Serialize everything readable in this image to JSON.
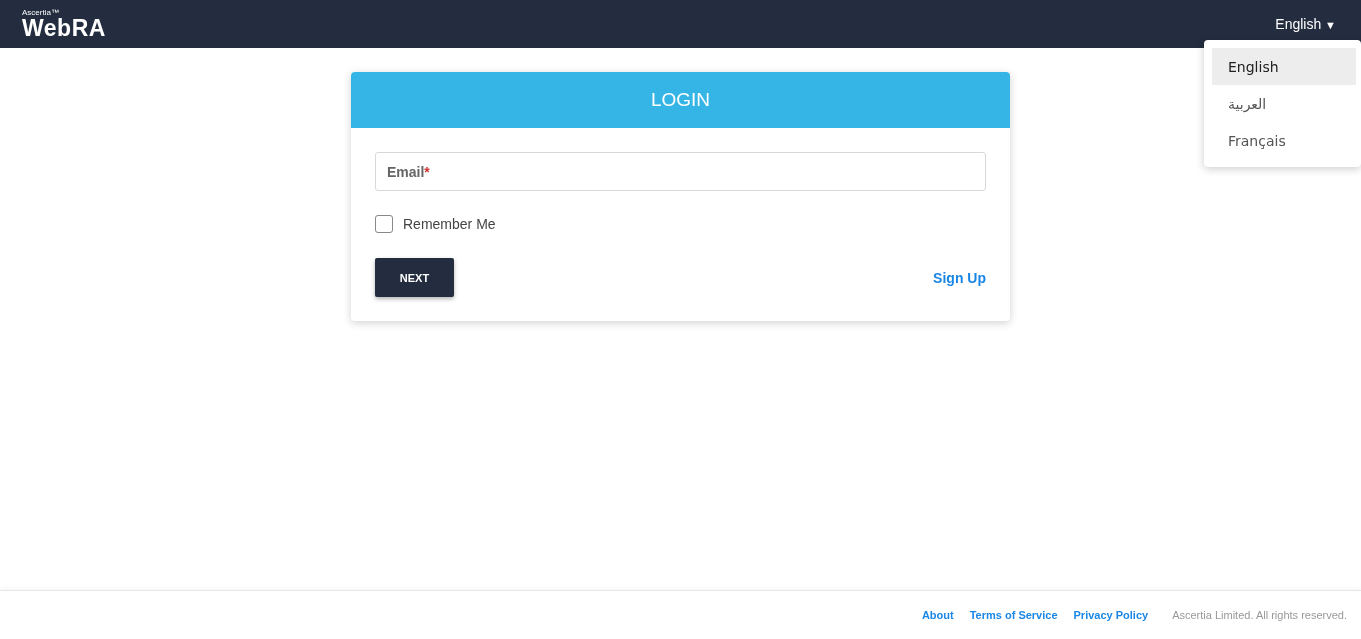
{
  "header": {
    "brand_small": "Ascertia™",
    "brand": "WebRA",
    "language": "English",
    "language_caret": "▼"
  },
  "language_menu": [
    {
      "label": "English",
      "selected": true
    },
    {
      "label": "العربية",
      "selected": false
    },
    {
      "label": "Français",
      "selected": false
    }
  ],
  "login": {
    "title": "LOGIN",
    "email_field": {
      "label": "Email",
      "required": true,
      "required_mark": "*"
    },
    "remember_me": {
      "label": "Remember Me",
      "checked": false
    },
    "next_button": "NEXT",
    "sign_up_link": "Sign Up"
  },
  "footer": {
    "links": [
      "About",
      "Terms of Service",
      "Privacy Policy"
    ],
    "copyright": "Ascertia Limited. All rights reserved."
  }
}
